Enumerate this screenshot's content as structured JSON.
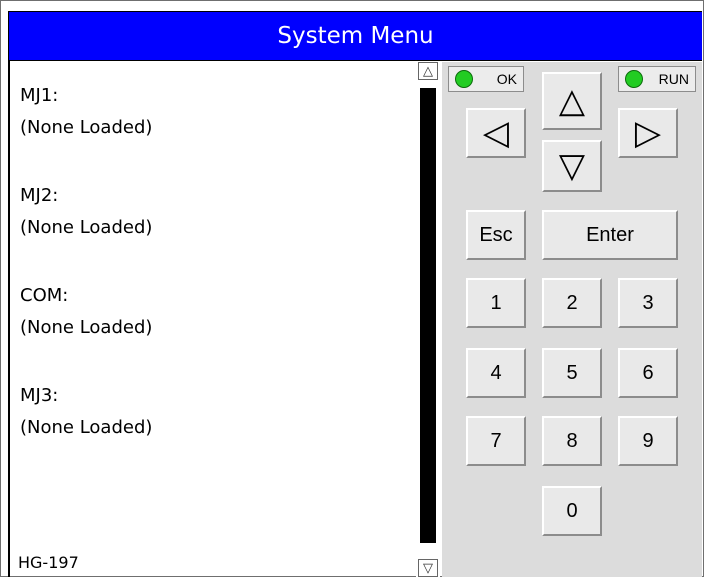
{
  "title": "System Menu",
  "entries": [
    {
      "label": "MJ1:",
      "value": "(None Loaded)"
    },
    {
      "label": "MJ2:",
      "value": "(None Loaded)"
    },
    {
      "label": "COM:",
      "value": "(None Loaded)"
    },
    {
      "label": "MJ3:",
      "value": "(None Loaded)"
    }
  ],
  "footer_label": "HG-197",
  "scroll": {
    "up_glyph": "△",
    "down_glyph": "▽"
  },
  "indicators": {
    "ok": "OK",
    "run": "RUN",
    "led_color": "#22cc22"
  },
  "keys": {
    "up": "△",
    "left": "◁",
    "right": "▷",
    "down": "▽",
    "esc": "Esc",
    "enter": "Enter",
    "k1": "1",
    "k2": "2",
    "k3": "3",
    "k4": "4",
    "k5": "5",
    "k6": "6",
    "k7": "7",
    "k8": "8",
    "k9": "9",
    "k0": "0"
  },
  "colors": {
    "title_bar": "#0000ff",
    "panel": "#dcdcdc",
    "key_face": "#e9e9e9"
  }
}
